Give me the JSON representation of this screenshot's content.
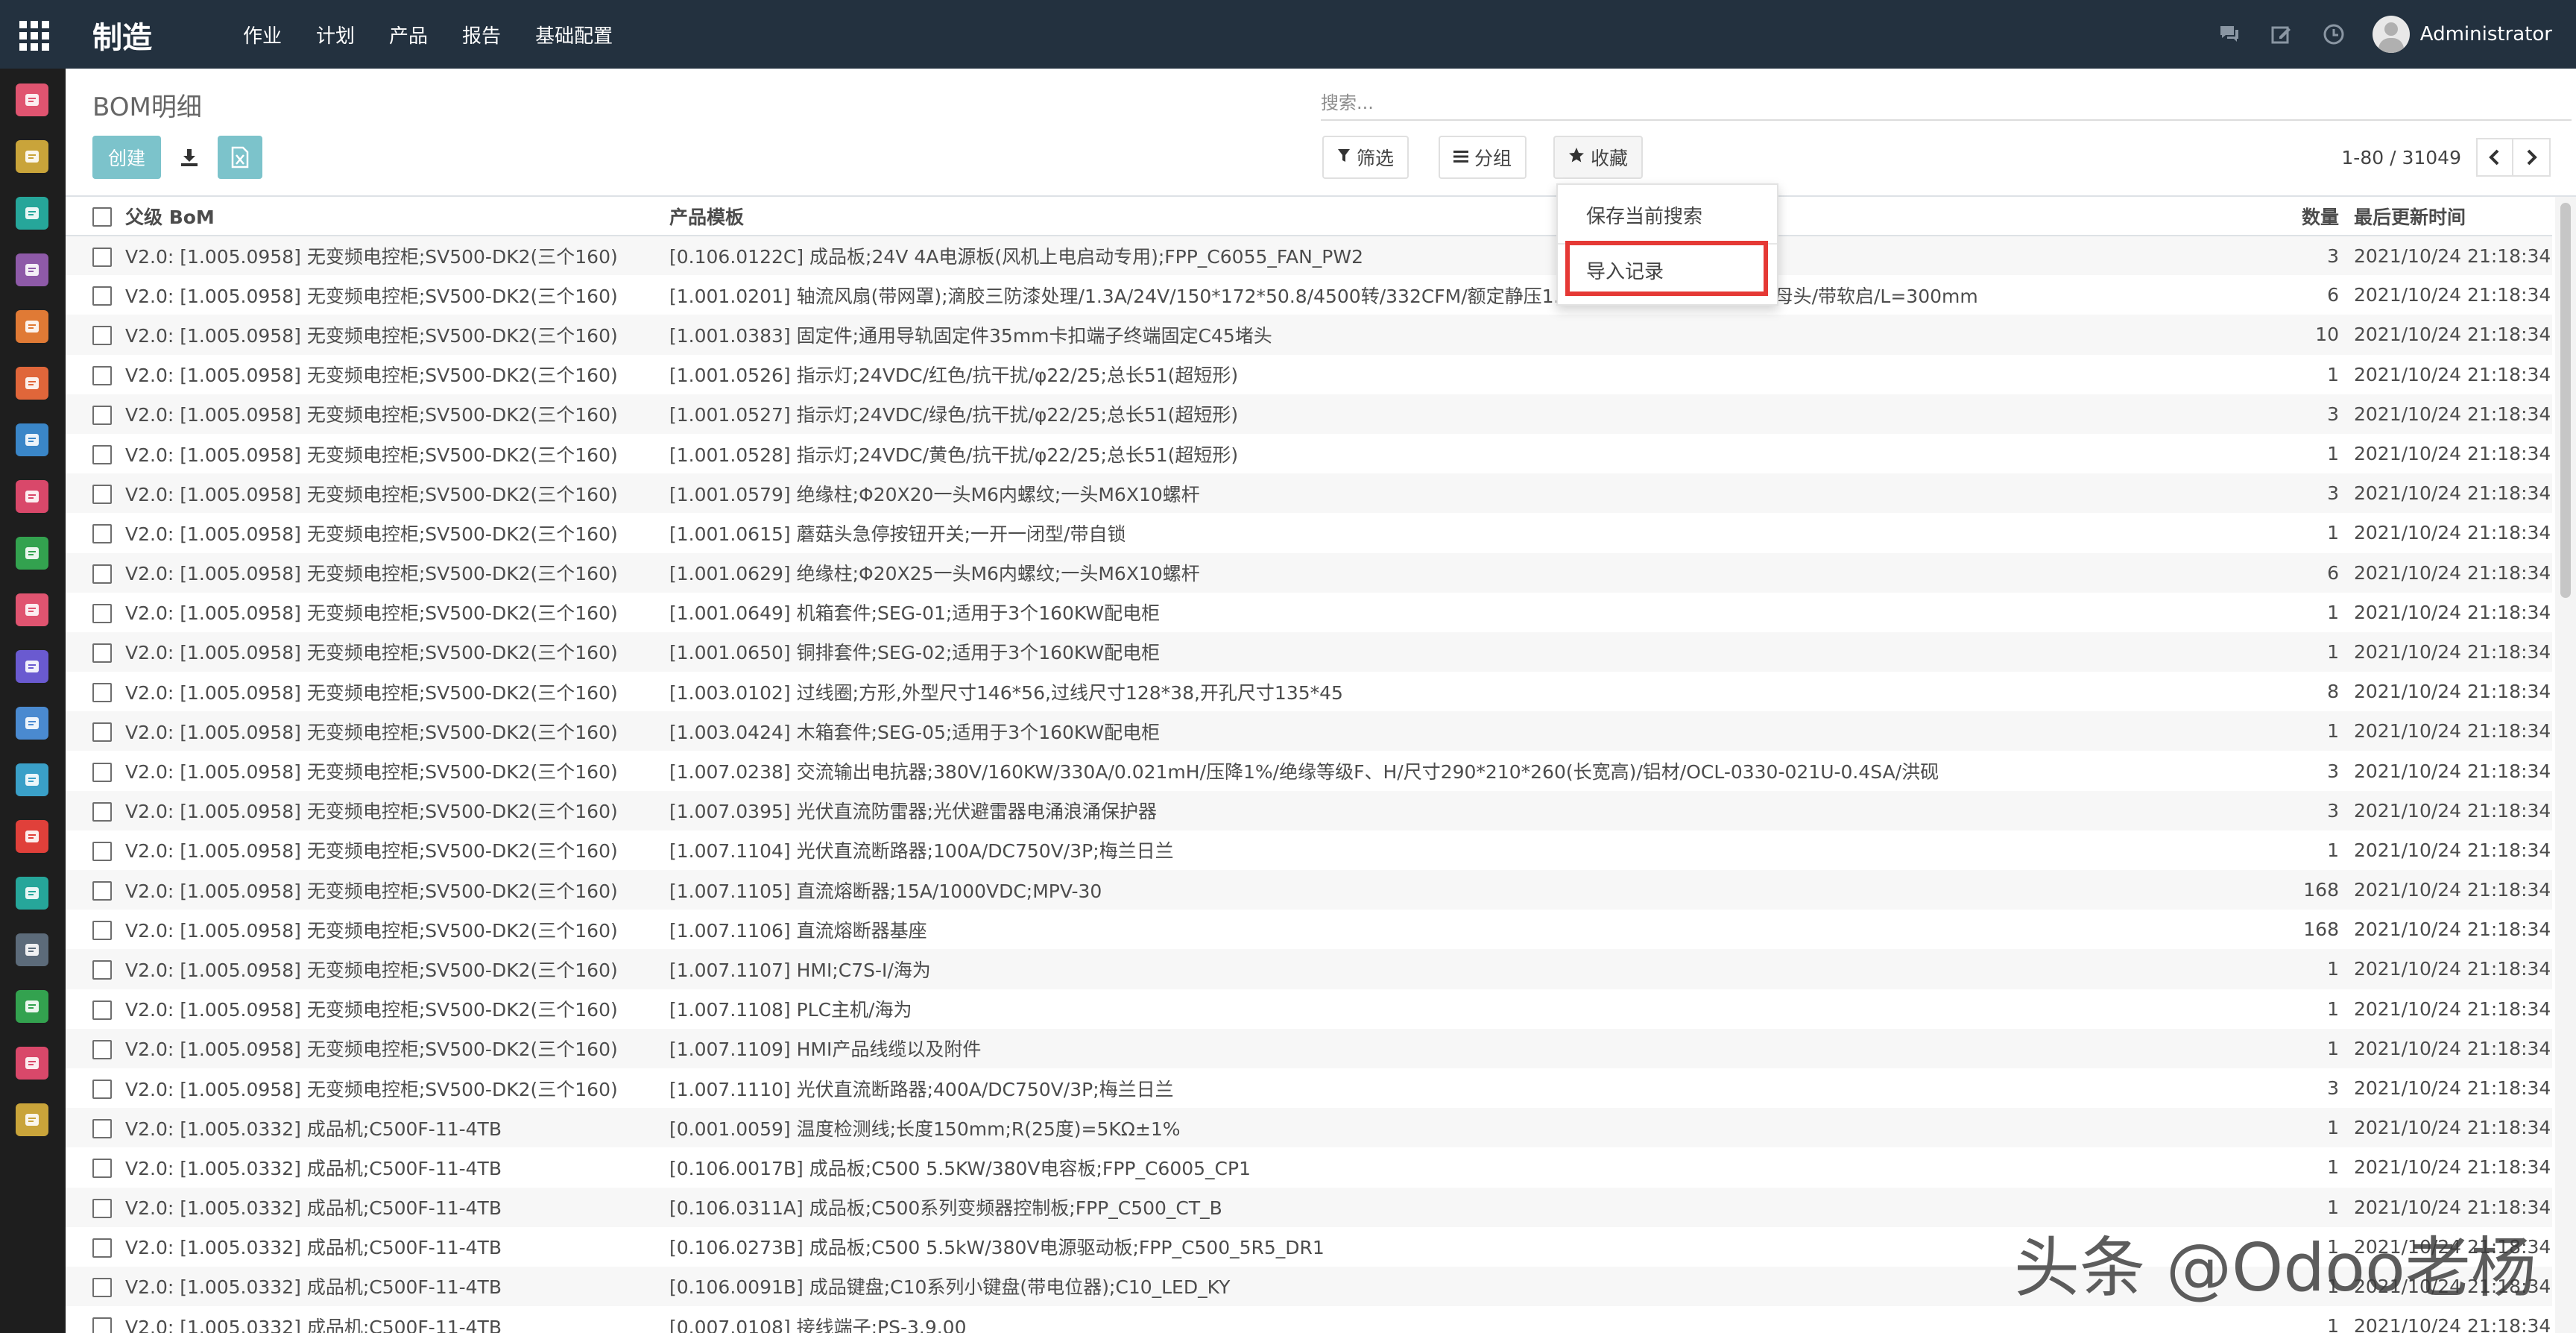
{
  "navbar": {
    "brand": "制造",
    "menu": [
      "作业",
      "计划",
      "产品",
      "报告",
      "基础配置"
    ],
    "user": "Administrator"
  },
  "appbar": {
    "apps": [
      {
        "name": "discuss",
        "color": "#e05470"
      },
      {
        "name": "calendar",
        "color": "#c9a43a"
      },
      {
        "name": "contacts",
        "color": "#26a69a"
      },
      {
        "name": "crm",
        "color": "#8e5aa8"
      },
      {
        "name": "sales",
        "color": "#e07a35"
      },
      {
        "name": "website",
        "color": "#e0663a"
      },
      {
        "name": "invoicing",
        "color": "#3a86c8"
      },
      {
        "name": "inventory",
        "color": "#d9486a"
      },
      {
        "name": "repair",
        "color": "#33a24f"
      },
      {
        "name": "documents",
        "color": "#e05470"
      },
      {
        "name": "apps-store",
        "color": "#6a5ad0"
      },
      {
        "name": "manufacturing",
        "color": "#4a8ad0"
      },
      {
        "name": "quality",
        "color": "#3aa0c8"
      },
      {
        "name": "timesheets",
        "color": "#e0403a"
      },
      {
        "name": "employees",
        "color": "#26a69a"
      },
      {
        "name": "payroll",
        "color": "#5c6b7a"
      },
      {
        "name": "approvals",
        "color": "#33a24f"
      },
      {
        "name": "recruitment",
        "color": "#d9486a"
      },
      {
        "name": "settings",
        "color": "#c9a43a"
      }
    ]
  },
  "control_panel": {
    "title": "BOM明细",
    "search_placeholder": "搜索...",
    "create_label": "创建",
    "filter_label": "筛选",
    "group_label": "分组",
    "favorites_label": "收藏",
    "pager_value": "1-80 / 31049"
  },
  "favorites_menu": {
    "save_search": "保存当前搜索",
    "import_records": "导入记录"
  },
  "list": {
    "columns": {
      "parent": "父级 BoM",
      "product": "产品模板",
      "qty": "数量",
      "date": "最后更新时间"
    },
    "rows": [
      {
        "parent": "V2.0: [1.005.0958] 无变频电控柜;SV500-DK2(三个160)",
        "product": "[0.106.0122C] 成品板;24V 4A电源板(风机上电启动专用);FPP_C6055_FAN_PW2",
        "qty": "3",
        "date": "2021/10/24 21:18:34"
      },
      {
        "parent": "V2.0: [1.005.0958] 无变频电控柜;SV500-DK2(三个160)",
        "product": "[1.001.0201] 轴流风扇(带网罩);滴胶三防漆处理/1.3A/24V/150*172*50.8/4500转/332CFM/额定静压1.45inch H2O/SM2.54-5P母头/带软启/L=300mm",
        "qty": "6",
        "date": "2021/10/24 21:18:34"
      },
      {
        "parent": "V2.0: [1.005.0958] 无变频电控柜;SV500-DK2(三个160)",
        "product": "[1.001.0383] 固定件;通用导轨固定件35mm卡扣端子终端固定C45堵头",
        "qty": "10",
        "date": "2021/10/24 21:18:34"
      },
      {
        "parent": "V2.0: [1.005.0958] 无变频电控柜;SV500-DK2(三个160)",
        "product": "[1.001.0526] 指示灯;24VDC/红色/抗干扰/φ22/25;总长51(超短形)",
        "qty": "1",
        "date": "2021/10/24 21:18:34"
      },
      {
        "parent": "V2.0: [1.005.0958] 无变频电控柜;SV500-DK2(三个160)",
        "product": "[1.001.0527] 指示灯;24VDC/绿色/抗干扰/φ22/25;总长51(超短形)",
        "qty": "3",
        "date": "2021/10/24 21:18:34"
      },
      {
        "parent": "V2.0: [1.005.0958] 无变频电控柜;SV500-DK2(三个160)",
        "product": "[1.001.0528] 指示灯;24VDC/黄色/抗干扰/φ22/25;总长51(超短形)",
        "qty": "1",
        "date": "2021/10/24 21:18:34"
      },
      {
        "parent": "V2.0: [1.005.0958] 无变频电控柜;SV500-DK2(三个160)",
        "product": "[1.001.0579] 绝缘柱;Φ20X20一头M6内螺纹;一头M6X10螺杆",
        "qty": "3",
        "date": "2021/10/24 21:18:34"
      },
      {
        "parent": "V2.0: [1.005.0958] 无变频电控柜;SV500-DK2(三个160)",
        "product": "[1.001.0615] 蘑菇头急停按钮开关;一开一闭型/带自锁",
        "qty": "1",
        "date": "2021/10/24 21:18:34"
      },
      {
        "parent": "V2.0: [1.005.0958] 无变频电控柜;SV500-DK2(三个160)",
        "product": "[1.001.0629] 绝缘柱;Φ20X25一头M6内螺纹;一头M6X10螺杆",
        "qty": "6",
        "date": "2021/10/24 21:18:34"
      },
      {
        "parent": "V2.0: [1.005.0958] 无变频电控柜;SV500-DK2(三个160)",
        "product": "[1.001.0649] 机箱套件;SEG-01;适用于3个160KW配电柜",
        "qty": "1",
        "date": "2021/10/24 21:18:34"
      },
      {
        "parent": "V2.0: [1.005.0958] 无变频电控柜;SV500-DK2(三个160)",
        "product": "[1.001.0650] 铜排套件;SEG-02;适用于3个160KW配电柜",
        "qty": "1",
        "date": "2021/10/24 21:18:34"
      },
      {
        "parent": "V2.0: [1.005.0958] 无变频电控柜;SV500-DK2(三个160)",
        "product": "[1.003.0102] 过线圈;方形,外型尺寸146*56,过线尺寸128*38,开孔尺寸135*45",
        "qty": "8",
        "date": "2021/10/24 21:18:34"
      },
      {
        "parent": "V2.0: [1.005.0958] 无变频电控柜;SV500-DK2(三个160)",
        "product": "[1.003.0424] 木箱套件;SEG-05;适用于3个160KW配电柜",
        "qty": "1",
        "date": "2021/10/24 21:18:34"
      },
      {
        "parent": "V2.0: [1.005.0958] 无变频电控柜;SV500-DK2(三个160)",
        "product": "[1.007.0238] 交流输出电抗器;380V/160KW/330A/0.021mH/压降1%/绝缘等级F、H/尺寸290*210*260(长宽高)/铝材/OCL-0330-021U-0.4SA/洪砚",
        "qty": "3",
        "date": "2021/10/24 21:18:34"
      },
      {
        "parent": "V2.0: [1.005.0958] 无变频电控柜;SV500-DK2(三个160)",
        "product": "[1.007.0395] 光伏直流防雷器;光伏避雷器电涌浪涌保护器",
        "qty": "3",
        "date": "2021/10/24 21:18:34"
      },
      {
        "parent": "V2.0: [1.005.0958] 无变频电控柜;SV500-DK2(三个160)",
        "product": "[1.007.1104] 光伏直流断路器;100A/DC750V/3P;梅兰日兰",
        "qty": "1",
        "date": "2021/10/24 21:18:34"
      },
      {
        "parent": "V2.0: [1.005.0958] 无变频电控柜;SV500-DK2(三个160)",
        "product": "[1.007.1105] 直流熔断器;15A/1000VDC;MPV-30",
        "qty": "168",
        "date": "2021/10/24 21:18:34"
      },
      {
        "parent": "V2.0: [1.005.0958] 无变频电控柜;SV500-DK2(三个160)",
        "product": "[1.007.1106] 直流熔断器基座",
        "qty": "168",
        "date": "2021/10/24 21:18:34"
      },
      {
        "parent": "V2.0: [1.005.0958] 无变频电控柜;SV500-DK2(三个160)",
        "product": "[1.007.1107] HMI;C7S-I/海为",
        "qty": "1",
        "date": "2021/10/24 21:18:34"
      },
      {
        "parent": "V2.0: [1.005.0958] 无变频电控柜;SV500-DK2(三个160)",
        "product": "[1.007.1108] PLC主机/海为",
        "qty": "1",
        "date": "2021/10/24 21:18:34"
      },
      {
        "parent": "V2.0: [1.005.0958] 无变频电控柜;SV500-DK2(三个160)",
        "product": "[1.007.1109] HMI产品线缆以及附件",
        "qty": "1",
        "date": "2021/10/24 21:18:34"
      },
      {
        "parent": "V2.0: [1.005.0958] 无变频电控柜;SV500-DK2(三个160)",
        "product": "[1.007.1110] 光伏直流断路器;400A/DC750V/3P;梅兰日兰",
        "qty": "3",
        "date": "2021/10/24 21:18:34"
      },
      {
        "parent": "V2.0: [1.005.0332] 成品机;C500F-11-4TB",
        "product": "[0.001.0059] 温度检测线;长度150mm;R(25度)=5KΩ±1%",
        "qty": "1",
        "date": "2021/10/24 21:18:34"
      },
      {
        "parent": "V2.0: [1.005.0332] 成品机;C500F-11-4TB",
        "product": "[0.106.0017B] 成品板;C500 5.5KW/380V电容板;FPP_C6005_CP1",
        "qty": "1",
        "date": "2021/10/24 21:18:34"
      },
      {
        "parent": "V2.0: [1.005.0332] 成品机;C500F-11-4TB",
        "product": "[0.106.0311A] 成品板;C500系列变频器控制板;FPP_C500_CT_B",
        "qty": "1",
        "date": "2021/10/24 21:18:34"
      },
      {
        "parent": "V2.0: [1.005.0332] 成品机;C500F-11-4TB",
        "product": "[0.106.0273B] 成品板;C500 5.5kW/380V电源驱动板;FPP_C500_5R5_DR1",
        "qty": "1",
        "date": "2021/10/24 21:18:34"
      },
      {
        "parent": "V2.0: [1.005.0332] 成品机;C500F-11-4TB",
        "product": "[0.106.0091B] 成品键盘;C10系列小键盘(带电位器);C10_LED_KY",
        "qty": "1",
        "date": "2021/10/24 21:18:34"
      },
      {
        "parent": "V2.0: [1.005.0332] 成品机;C500F-11-4TB",
        "product": "[0.007.0108] 接线端子;PS-3.9.00",
        "qty": "1",
        "date": "2021/10/24 21:18:34"
      }
    ]
  },
  "watermark": "头条 @Odoo老杨",
  "colors": {
    "navbar": "#23313f",
    "primary_button": "#7cc3cb",
    "highlight": "#e53935"
  }
}
